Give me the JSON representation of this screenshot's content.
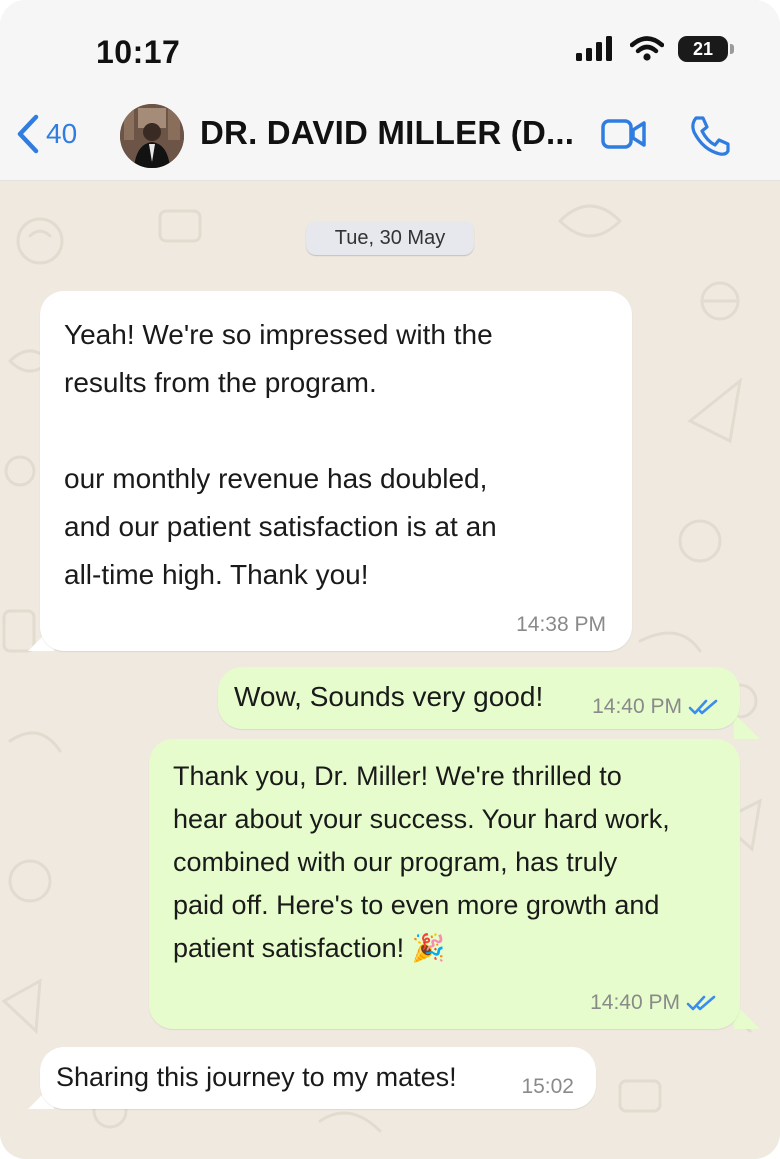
{
  "status_bar": {
    "time": "10:17",
    "battery": "21"
  },
  "header": {
    "back_count": "40",
    "contact_name": "DR. DAVID MILLER (D..."
  },
  "date_separator": "Tue, 30 May",
  "messages": [
    {
      "direction": "incoming",
      "text": "Yeah! We're so impressed with the\nresults from the program.\n\nour monthly revenue has doubled,\nand our patient satisfaction is at an\nall-time high. Thank you!",
      "time": "14:38 PM"
    },
    {
      "direction": "outgoing",
      "text": "Wow, Sounds very good!",
      "time": "14:40 PM",
      "status": "read"
    },
    {
      "direction": "outgoing",
      "text": "Thank you, Dr. Miller! We're thrilled to\nhear about your success. Your hard work,\ncombined with our program, has truly\npaid off. Here's to even more growth and\npatient satisfaction! 🎉",
      "time": "14:40 PM",
      "status": "read"
    },
    {
      "direction": "incoming",
      "text": "Sharing this journey to my mates!",
      "time": "15:02"
    }
  ],
  "colors": {
    "accent": "#2f7de0",
    "outgoing_bubble": "#e6fccc",
    "incoming_bubble": "#ffffff",
    "chat_background": "#efe9df"
  },
  "icons": {
    "back": "chevron-left-icon",
    "video": "video-camera-icon",
    "call": "phone-icon",
    "read_receipt": "double-check-icon"
  }
}
